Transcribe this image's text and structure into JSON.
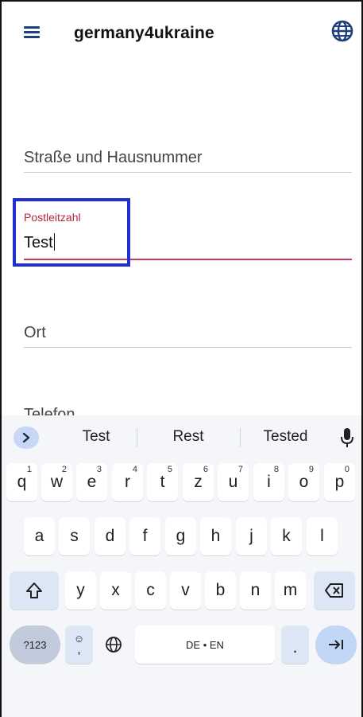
{
  "app": {
    "title": "germany4ukraine"
  },
  "form": {
    "street_label": "Straße und Hausnummer",
    "postcode_label": "Postleitzahl",
    "postcode_value": "Test",
    "city_label": "Ort",
    "phone_label_partial": "Telefon"
  },
  "keyboard": {
    "suggestions": [
      "Test",
      "Rest",
      "Tested"
    ],
    "row1": [
      {
        "key": "q",
        "hint": "1"
      },
      {
        "key": "w",
        "hint": "2"
      },
      {
        "key": "e",
        "hint": "3"
      },
      {
        "key": "r",
        "hint": "4"
      },
      {
        "key": "t",
        "hint": "5"
      },
      {
        "key": "z",
        "hint": "6"
      },
      {
        "key": "u",
        "hint": "7"
      },
      {
        "key": "i",
        "hint": "8"
      },
      {
        "key": "o",
        "hint": "9"
      },
      {
        "key": "p",
        "hint": "0"
      }
    ],
    "row2": [
      "a",
      "s",
      "d",
      "f",
      "g",
      "h",
      "j",
      "k",
      "l"
    ],
    "row3": [
      "y",
      "x",
      "c",
      "v",
      "b",
      "n",
      "m"
    ],
    "symbols_label": "?123",
    "emoji_comma": ",",
    "space_label": "DE • EN",
    "period_label": "."
  },
  "colors": {
    "accent_error": "#b5283e",
    "highlight_box": "#1f2fd1",
    "menu_icon": "#1e3f7a"
  }
}
